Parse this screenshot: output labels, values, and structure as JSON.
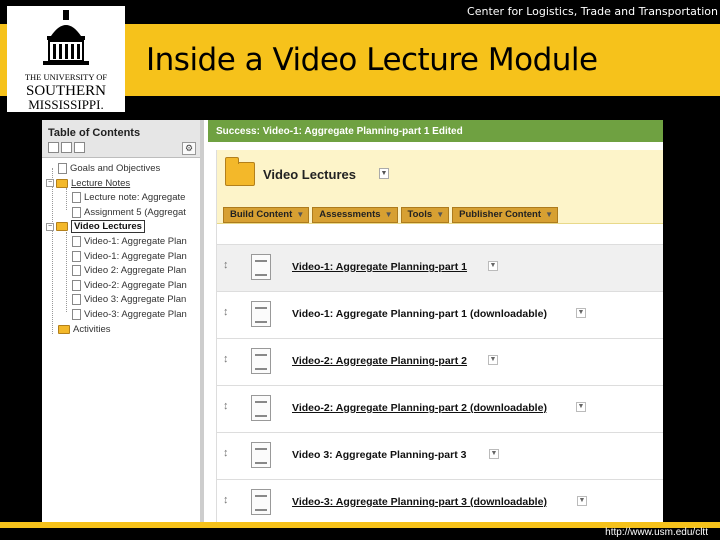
{
  "header": {
    "center_name": "Center for Logistics, Trade and Transportation",
    "slide_title": "Inside a Video Lecture Module",
    "footer_url": "http://www.usm.edu/cltt"
  },
  "logo": {
    "line1": "THE UNIVERSITY OF",
    "line2": "SOUTHERN",
    "line3": "MISSISSIPPI."
  },
  "toc": {
    "title": "Table of Contents",
    "items": [
      {
        "label": "Goals and Objectives",
        "type": "doc",
        "level": 1
      },
      {
        "label": "Lecture Notes",
        "type": "folder",
        "level": 1
      },
      {
        "label": "Lecture note: Aggregate",
        "type": "doc",
        "level": 2
      },
      {
        "label": "Assignment 5 (Aggregat",
        "type": "doc",
        "level": 2
      },
      {
        "label": "Video Lectures",
        "type": "folder",
        "level": 1,
        "selected": true
      },
      {
        "label": "Video-1: Aggregate Plan",
        "type": "doc",
        "level": 2
      },
      {
        "label": "Video-1: Aggregate Plan",
        "type": "doc",
        "level": 2
      },
      {
        "label": "Video 2: Aggregate Plan",
        "type": "doc",
        "level": 2
      },
      {
        "label": "Video-2: Aggregate Plan",
        "type": "doc",
        "level": 2
      },
      {
        "label": "Video 3: Aggregate Plan",
        "type": "doc",
        "level": 2
      },
      {
        "label": "Video-3: Aggregate Plan",
        "type": "doc",
        "level": 2
      },
      {
        "label": "Activities",
        "type": "folder",
        "level": 1
      }
    ]
  },
  "content": {
    "success_message": "Success: Video-1: Aggregate Planning-part 1 Edited",
    "page_title": "Video Lectures",
    "menu": [
      {
        "label": "Build Content"
      },
      {
        "label": "Assessments"
      },
      {
        "label": "Tools"
      },
      {
        "label": "Publisher Content"
      }
    ],
    "items": [
      {
        "title": "Video-1: Aggregate Planning-part 1"
      },
      {
        "title": "Video-1: Aggregate Planning-part 1 (downloadable)"
      },
      {
        "title": "Video-2: Aggregate Planning-part 2"
      },
      {
        "title": "Video-2: Aggregate Planning-part 2 (downloadable)"
      },
      {
        "title": "Video 3: Aggregate Planning-part 3"
      },
      {
        "title": "Video-3: Aggregate Planning-part 3 (downloadable)"
      }
    ]
  },
  "icons": {
    "drag": "drag-handle-icon",
    "chevron": "chevron-down-icon",
    "folder": "folder-icon",
    "document": "document-icon",
    "gear": "gear-icon"
  },
  "colors": {
    "brand_gold": "#f6c21b",
    "success_green": "#6fa141",
    "menu_gold": "#d7a032"
  }
}
